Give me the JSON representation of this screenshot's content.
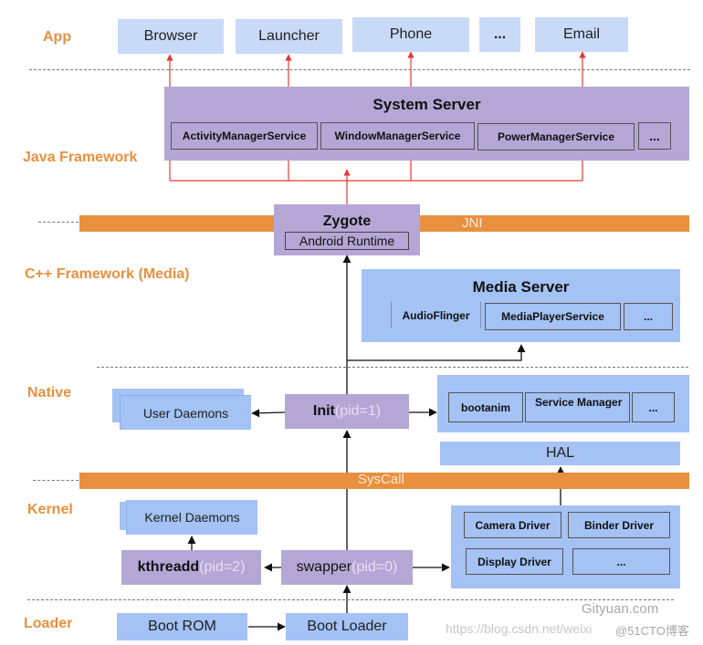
{
  "layers": {
    "app": "App",
    "java_framework": "Java Framework",
    "cpp_framework": "C++ Framework (Media)",
    "native": "Native",
    "kernel": "Kernel",
    "loader": "Loader"
  },
  "apps": [
    "Browser",
    "Launcher",
    "Phone",
    "...",
    "Email"
  ],
  "system_server": {
    "title": "System Server",
    "services": [
      "ActivityManagerService",
      "WindowManagerService",
      "PowerManagerService",
      "..."
    ]
  },
  "jni": {
    "label": "JNI"
  },
  "zygote": {
    "title": "Zygote",
    "runtime": "Android Runtime"
  },
  "media_server": {
    "title": "Media Server",
    "services": [
      "AudioFlinger",
      "MediaPlayerService",
      "..."
    ]
  },
  "native": {
    "user_daemons": "User Daemons",
    "init_name": "Init",
    "init_pid": "(pid=1)",
    "services": [
      "bootanim",
      "Service Manager",
      "..."
    ],
    "hal": "HAL"
  },
  "syscall": {
    "label": "SysCall"
  },
  "kernel": {
    "kernel_daemons": "Kernel Daemons",
    "kthreadd_name": "kthreadd",
    "kthreadd_pid": "(pid=2)",
    "swapper_name": "swapper",
    "swapper_pid": "(pid=0)",
    "drivers": [
      "Camera Driver",
      "Binder Driver",
      "Display Driver",
      "..."
    ]
  },
  "loader": {
    "boot_rom": "Boot  ROM",
    "boot_loader": "Boot Loader"
  },
  "watermarks": {
    "site": "Gityuan.com",
    "url": "https://blog.csdn.net/weixi",
    "cto": "@51CTO博客"
  }
}
